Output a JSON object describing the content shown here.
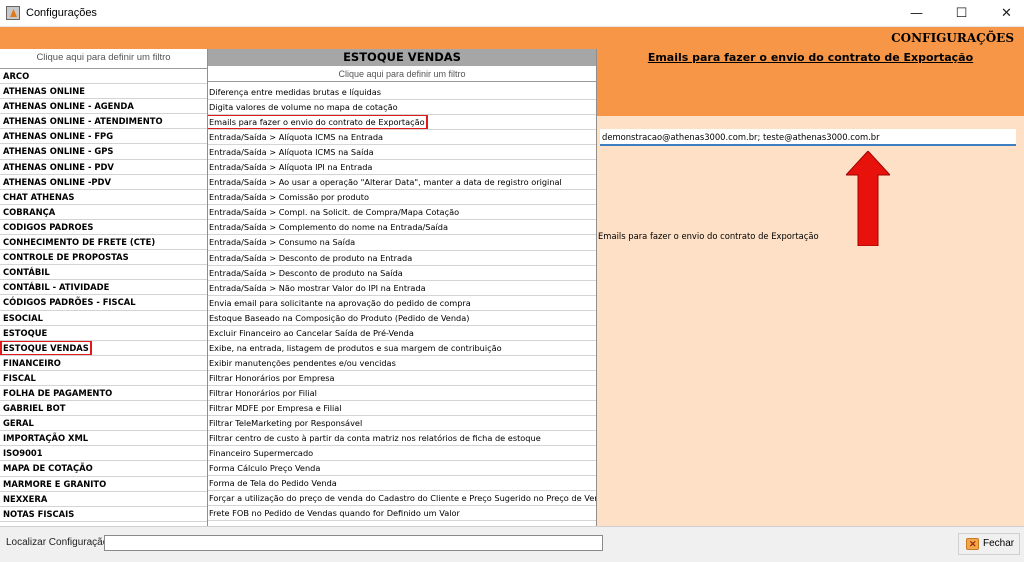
{
  "window": {
    "title": "Configurações",
    "minimize": "—",
    "maximize": "☐",
    "close": "✕"
  },
  "header": {
    "title": "CONFIGURAÇÕES"
  },
  "left": {
    "filter_hint": "Clique aqui para definir um filtro",
    "items": [
      "ARCO",
      "ATHENAS ONLINE",
      "ATHENAS ONLINE - AGENDA",
      "ATHENAS ONLINE - ATENDIMENTO",
      "ATHENAS ONLINE - FPG",
      "ATHENAS ONLINE - GPS",
      "ATHENAS ONLINE - PDV",
      "ATHENAS ONLINE -PDV",
      "CHAT ATHENAS",
      "COBRANÇA",
      "CODIGOS PADROES",
      "CONHECIMENTO DE FRETE (CTE)",
      "CONTROLE DE PROPOSTAS",
      "CONTÁBIL",
      "CONTÁBIL - ATIVIDADE",
      "CÓDIGOS PADRÕES - FISCAL",
      "ESOCIAL",
      "ESTOQUE",
      "ESTOQUE VENDAS",
      "FINANCEIRO",
      "FISCAL",
      "FOLHA DE PAGAMENTO",
      "GABRIEL BOT",
      "GERAL",
      "IMPORTAÇÃO XML",
      "ISO9001",
      "MAPA DE COTAÇÃO",
      "MARMORE E GRANITO",
      "NEXXERA",
      "NOTAS FISCAIS"
    ],
    "selected_index": 18
  },
  "middle": {
    "title": "ESTOQUE VENDAS",
    "filter_hint": "Clique aqui para definir um filtro",
    "items": [
      "Diferença entre medidas brutas e líquidas",
      "Digita valores de volume no mapa de cotação",
      "Emails para fazer o envio do contrato de Exportação",
      "Entrada/Saída > Alíquota ICMS na Entrada",
      "Entrada/Saída > Alíquota ICMS na Saída",
      "Entrada/Saída > Alíquota IPI na Entrada",
      "Entrada/Saída > Ao usar a operação \"Alterar Data\", manter a data de registro original",
      "Entrada/Saída > Comissão por produto",
      "Entrada/Saída > Compl. na Solicit. de Compra/Mapa Cotação",
      "Entrada/Saída > Complemento do nome na Entrada/Saída",
      "Entrada/Saída > Consumo na Saída",
      "Entrada/Saída > Desconto de produto na Entrada",
      "Entrada/Saída > Desconto de produto na Saída",
      "Entrada/Saída > Não mostrar Valor do IPI na Entrada",
      "Envia email para solicitante na aprovação do pedido de compra",
      "Estoque Baseado na Composição do Produto (Pedido de Venda)",
      "Excluir Financeiro ao Cancelar Saída de Pré-Venda",
      "Exibe, na entrada, listagem de produtos e sua margem de contribuição",
      "Exibir manutenções pendentes e/ou vencidas",
      "Filtrar Honorários por Empresa",
      "Filtrar Honorários por Filial",
      "Filtrar MDFE por Empresa e Filial",
      "Filtrar TeleMarketing por Responsável",
      "Filtrar centro de custo à partir da conta matriz nos relatórios de ficha de estoque",
      "Financeiro Supermercado",
      "Forma Cálculo Preço Venda",
      "Forma de Tela do Pedido Venda",
      "Forçar a utilização do preço de venda do Cadastro do Cliente e Preço Sugerido no Preço de Venda",
      "Frete FOB no Pedido de Vendas quando for Definido um Valor"
    ],
    "selected_index": 2
  },
  "right": {
    "title": "Emails para fazer o envio do contrato de Exportação",
    "value": "demonstracao@athenas3000.com.br; teste@athenas3000.com.br",
    "description": "Emails para fazer o envio do contrato de Exportação",
    "arrow_color": "#e8120c"
  },
  "bottom": {
    "search_label": "Localizar Configuração:",
    "search_value": "",
    "close_label": "Fechar"
  },
  "colors": {
    "accent": "#f79646",
    "panel_bg": "#fde0c5",
    "highlight": "#e01a1a"
  }
}
